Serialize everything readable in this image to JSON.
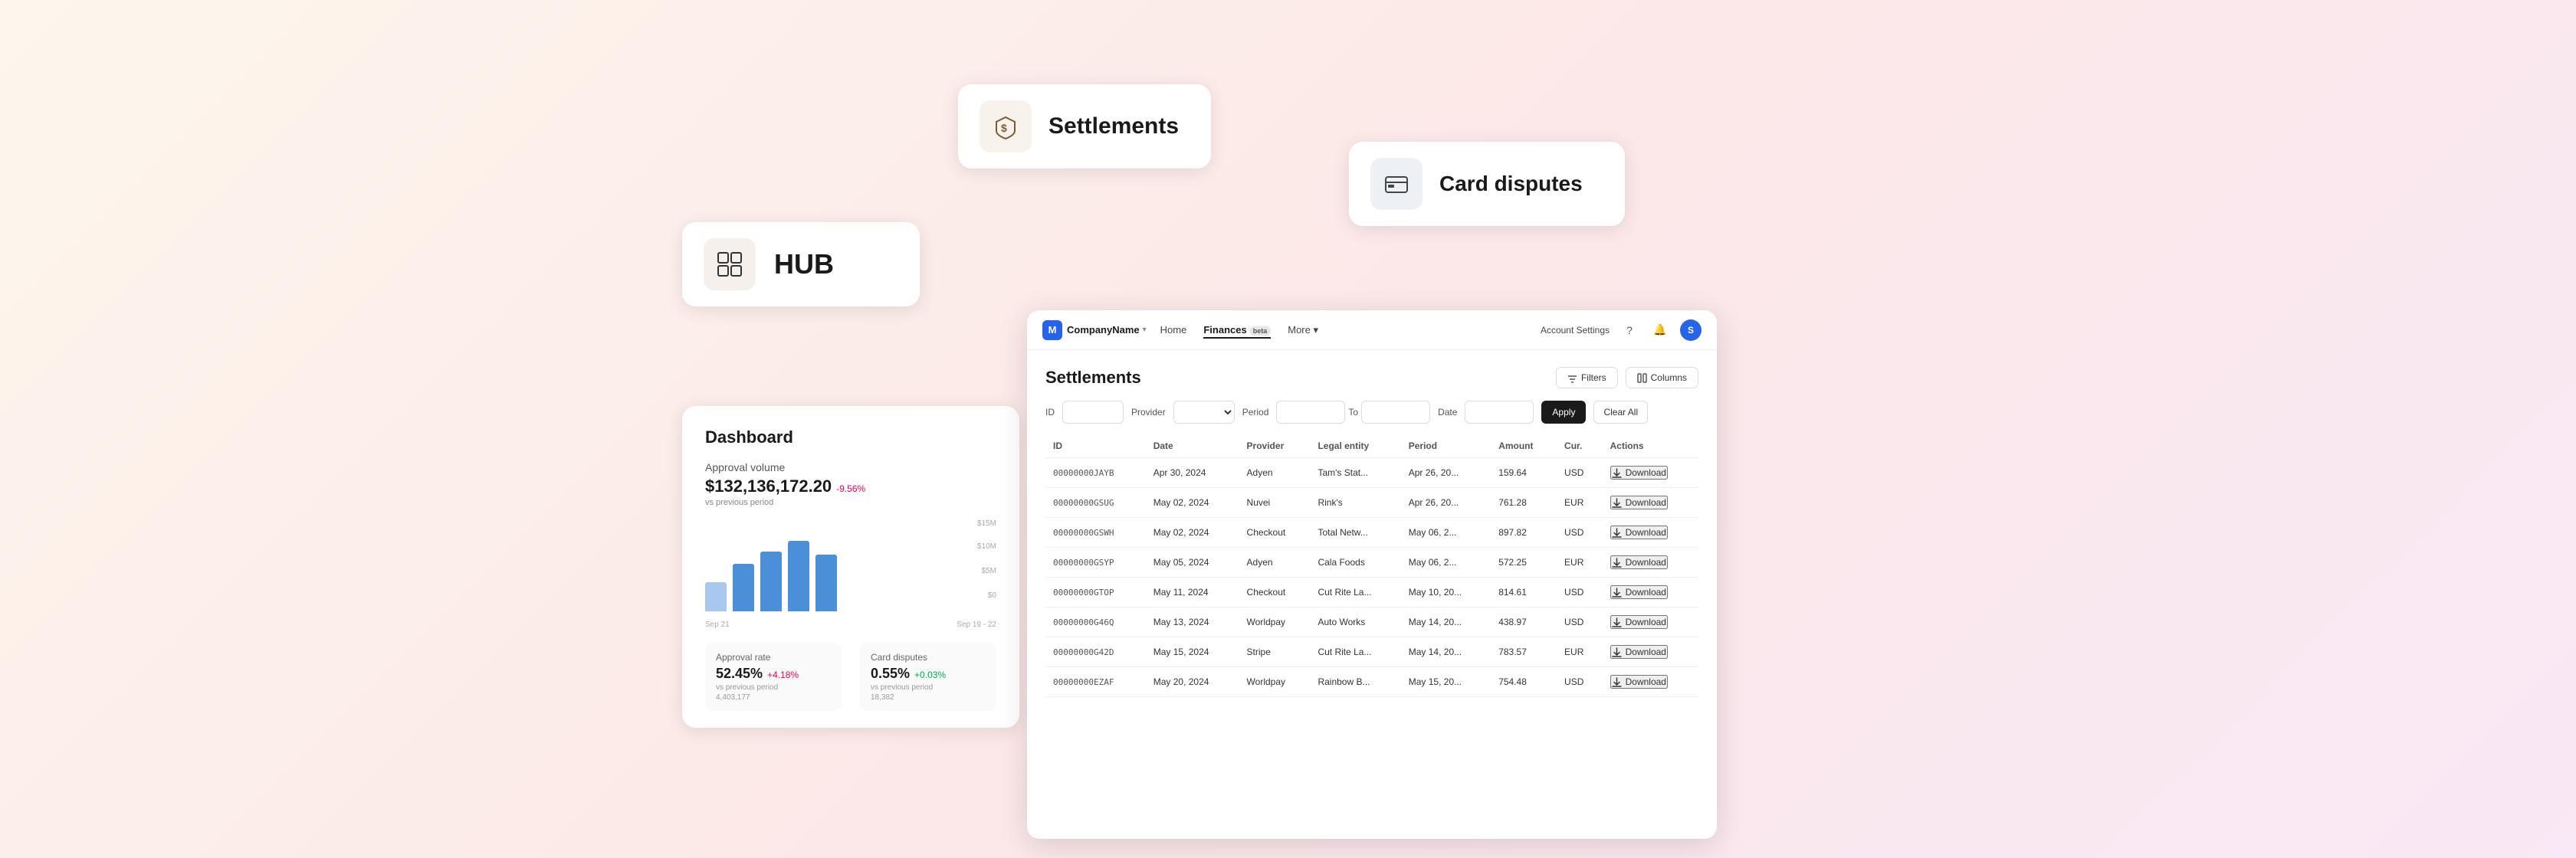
{
  "hub_card": {
    "label": "HUB",
    "icon": "⊞"
  },
  "settlements_card": {
    "label": "Settlements",
    "icon": "🛡"
  },
  "disputes_card": {
    "label": "Card disputes",
    "icon": "💳"
  },
  "dashboard": {
    "title": "Dashboard",
    "approval_volume": {
      "label": "Approval volume",
      "value": "$132,136,172.20",
      "change": "-9.56%",
      "sub": "vs previous period",
      "chart_y_labels": [
        "$15M",
        "$10M",
        "$5M",
        "$0"
      ],
      "x_labels": [
        "Sep 21",
        "Sep 19 - 22"
      ],
      "bars": [
        {
          "height": 35,
          "light": true
        },
        {
          "height": 58,
          "light": false
        },
        {
          "height": 72,
          "light": false
        },
        {
          "height": 80,
          "light": false
        },
        {
          "height": 68,
          "light": false
        }
      ]
    },
    "approval_rate": {
      "label": "Approval rate",
      "value": "52.45%",
      "change": "+4.18%",
      "sub": "vs previous period",
      "sub2": "4,403,177"
    },
    "card_disputes": {
      "label": "Card disputes",
      "value": "0.55%",
      "change": "+0.03%",
      "sub": "vs previous period",
      "sub2": "18,382"
    }
  },
  "app": {
    "nav": {
      "company_initial": "M",
      "company_name": "CompanyName",
      "links": [
        "Home",
        "Finances",
        "More ▾"
      ],
      "finances_badge": "beta",
      "right": {
        "account_settings": "Account Settings",
        "help_icon": "?",
        "bell_icon": "🔔",
        "avatar": "S"
      }
    },
    "page_title": "Settlements",
    "filters_btn": "Filters",
    "columns_btn": "Columns",
    "filter_bar": {
      "id_placeholder": "",
      "provider_label": "Provider",
      "period_label": "Period",
      "date_label": "Date",
      "to_label": "To",
      "apply_label": "Apply",
      "clear_label": "Clear All"
    },
    "table": {
      "columns": [
        "ID",
        "Date",
        "Provider",
        "Legal entity",
        "Period",
        "Amount",
        "Cur.",
        "Actions"
      ],
      "rows": [
        {
          "id": "00000000JAYB",
          "date": "Apr 30, 2024",
          "provider": "Adyen",
          "legal": "Tam's Stat...",
          "period": "Apr 26, 20...",
          "amount": "159.64",
          "currency": "USD",
          "action": "Download"
        },
        {
          "id": "00000000GSUG",
          "date": "May 02, 2024",
          "provider": "Nuvei",
          "legal": "Rink's",
          "period": "Apr 26, 20...",
          "amount": "761.28",
          "currency": "EUR",
          "action": "Download"
        },
        {
          "id": "00000000GSWH",
          "date": "May 02, 2024",
          "provider": "Checkout",
          "legal": "Total Netw...",
          "period": "May 06, 2...",
          "amount": "897.82",
          "currency": "USD",
          "action": "Download"
        },
        {
          "id": "00000000GSYP",
          "date": "May 05, 2024",
          "provider": "Adyen",
          "legal": "Cala Foods",
          "period": "May 06, 2...",
          "amount": "572.25",
          "currency": "EUR",
          "action": "Download"
        },
        {
          "id": "00000000GTOP",
          "date": "May 11, 2024",
          "provider": "Checkout",
          "legal": "Cut Rite La...",
          "period": "May 10, 20...",
          "amount": "814.61",
          "currency": "USD",
          "action": "Download"
        },
        {
          "id": "00000000G46Q",
          "date": "May 13, 2024",
          "provider": "Worldpay",
          "legal": "Auto Works",
          "period": "May 14, 20...",
          "amount": "438.97",
          "currency": "USD",
          "action": "Download"
        },
        {
          "id": "00000000G42D",
          "date": "May 15, 2024",
          "provider": "Stripe",
          "legal": "Cut Rite La...",
          "period": "May 14, 20...",
          "amount": "783.57",
          "currency": "EUR",
          "action": "Download"
        },
        {
          "id": "00000000EZAF",
          "date": "May 20, 2024",
          "provider": "Worldpay",
          "legal": "Rainbow B...",
          "period": "May 15, 20...",
          "amount": "754.48",
          "currency": "USD",
          "action": "Download"
        }
      ]
    }
  }
}
